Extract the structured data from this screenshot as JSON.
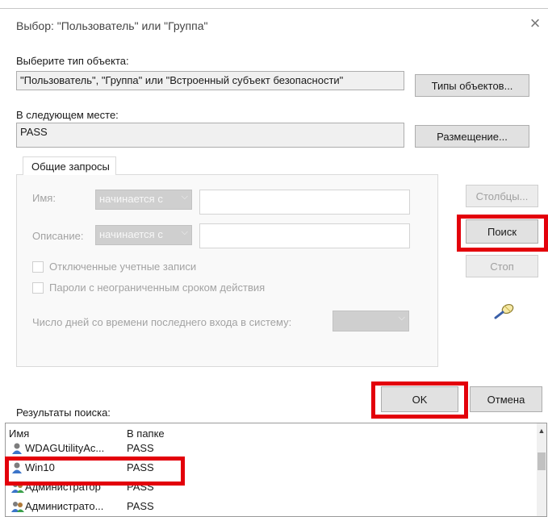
{
  "dialog": {
    "title": "Выбор: \"Пользователь\" или \"Группа\"",
    "object_type_label": "Выберите тип объекта:",
    "object_type_value": "\"Пользователь\", \"Группа\" или \"Встроенный субъект безопасности\"",
    "object_types_button": "Типы объектов...",
    "location_label": "В следующем месте:",
    "location_value": "PASS",
    "locations_button": "Размещение..."
  },
  "query": {
    "tab_label": "Общие запросы",
    "name_label": "Имя:",
    "name_combo": "начинается с",
    "description_label": "Описание:",
    "description_combo": "начинается с",
    "disabled_accounts_label": "Отключенные учетные записи",
    "non_expiring_label": "Пароли с неограниченным сроком действия",
    "days_label": "Число дней со времени последнего входа в систему:",
    "columns_button": "Столбцы...",
    "find_button": "Поиск",
    "stop_button": "Стоп"
  },
  "actions": {
    "ok_button": "OK",
    "cancel_button": "Отмена"
  },
  "results": {
    "label": "Результаты поиска:",
    "columns": [
      "Имя",
      "В папке"
    ],
    "rows": [
      {
        "name": "WDAGUtilityAc...",
        "folder": "PASS"
      },
      {
        "name": "Win10",
        "folder": "PASS"
      },
      {
        "name": "Администратор",
        "folder": "PASS"
      },
      {
        "name": "Администрато...",
        "folder": "PASS"
      }
    ]
  },
  "colors": {
    "highlight": "#e3000b",
    "button_face": "#e1e1e1"
  }
}
